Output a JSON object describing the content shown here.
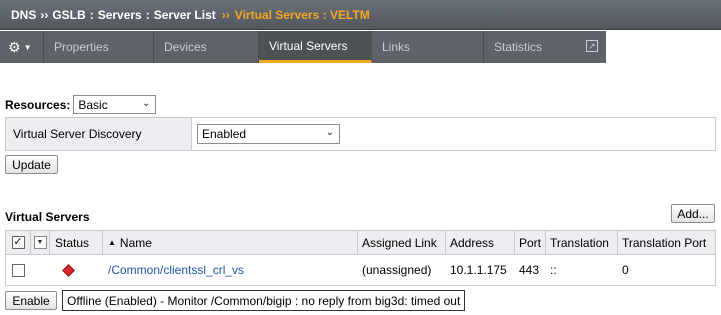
{
  "breadcrumb": {
    "items": [
      "DNS",
      "GSLB",
      "Servers",
      "Server List"
    ],
    "separator": ":",
    "current": "Virtual Servers : VELTM"
  },
  "tabs": [
    {
      "label": "Properties"
    },
    {
      "label": "Devices"
    },
    {
      "label": "Virtual Servers",
      "active": true
    },
    {
      "label": "Links"
    },
    {
      "label": "Statistics"
    }
  ],
  "resources": {
    "label": "Resources:",
    "value": "Basic"
  },
  "discovery": {
    "label": "Virtual Server Discovery",
    "value": "Enabled"
  },
  "update_label": "Update",
  "virtual_servers": {
    "title": "Virtual Servers",
    "add_label": "Add...",
    "columns": [
      "Status",
      "Name",
      "Assigned Link",
      "Address",
      "Port",
      "Translation",
      "Translation Port"
    ],
    "rows": [
      {
        "status": "offline",
        "name": "/Common/clientssl_crl_vs",
        "assigned_link": "(unassigned)",
        "address": "10.1.1.175",
        "port": "443",
        "translation": "::",
        "translation_port": "0"
      }
    ]
  },
  "enable_label": "Enable",
  "tooltip": "Offline (Enabled)  -  Monitor /Common/bigip : no reply from big3d: timed out",
  "colors": {
    "accent": "#f5a623",
    "status_offline": "#d8262c",
    "link": "#1f55a8"
  }
}
